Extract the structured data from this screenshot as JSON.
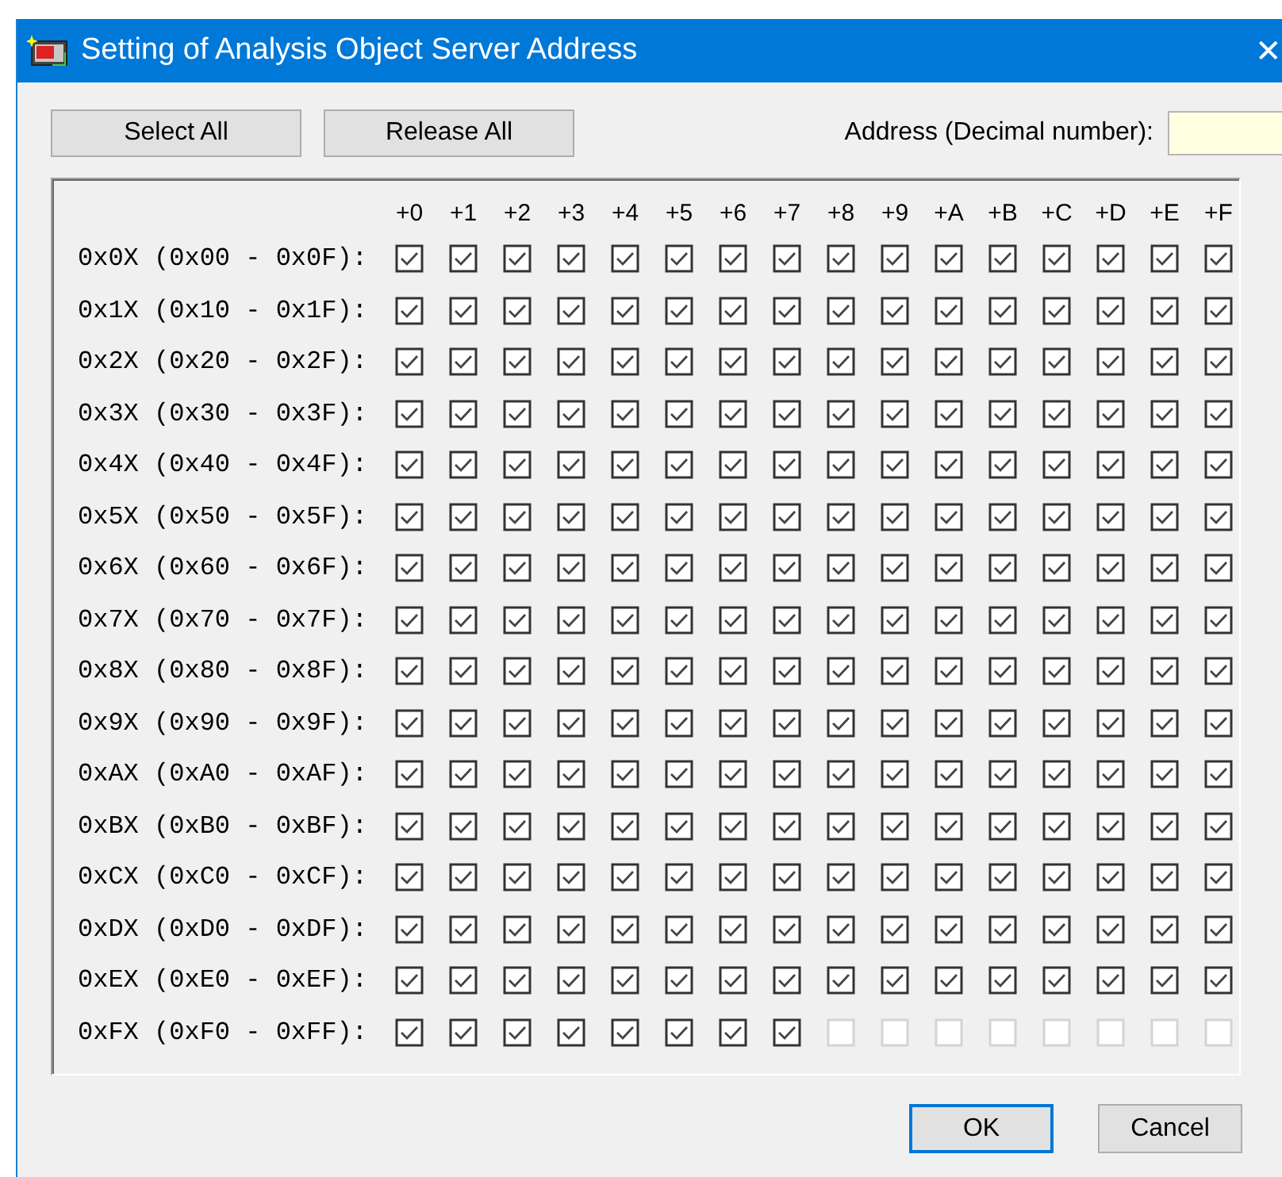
{
  "window": {
    "title": "Setting of Analysis Object Server Address",
    "close": "✕"
  },
  "buttons": [
    {
      "label": "Select All"
    },
    {
      "label": "Release All"
    }
  ],
  "address": {
    "label": "Address (Decimal number):"
  },
  "columns": [
    "+0",
    "+1",
    "+2",
    "+3",
    "+4",
    "+5",
    "+6",
    "+7",
    "+8",
    "+9",
    "+A",
    "+B",
    "+C",
    "+D",
    "+E",
    "+F"
  ],
  "rows": [
    {
      "label": "0x0X (0x00 - 0x0F):",
      "cells": [
        {
          "checked": true,
          "disabled": false
        },
        {
          "checked": true,
          "disabled": false
        },
        {
          "checked": true,
          "disabled": false
        },
        {
          "checked": true,
          "disabled": false
        },
        {
          "checked": true,
          "disabled": false
        },
        {
          "checked": true,
          "disabled": false
        },
        {
          "checked": true,
          "disabled": false
        },
        {
          "checked": true,
          "disabled": false
        },
        {
          "checked": true,
          "disabled": false
        },
        {
          "checked": true,
          "disabled": false
        },
        {
          "checked": true,
          "disabled": false
        },
        {
          "checked": true,
          "disabled": false
        },
        {
          "checked": true,
          "disabled": false
        },
        {
          "checked": true,
          "disabled": false
        },
        {
          "checked": true,
          "disabled": false
        },
        {
          "checked": true,
          "disabled": false
        }
      ]
    },
    {
      "label": "0x1X (0x10 - 0x1F):",
      "cells": [
        {
          "checked": true,
          "disabled": false
        },
        {
          "checked": true,
          "disabled": false
        },
        {
          "checked": true,
          "disabled": false
        },
        {
          "checked": true,
          "disabled": false
        },
        {
          "checked": true,
          "disabled": false
        },
        {
          "checked": true,
          "disabled": false
        },
        {
          "checked": true,
          "disabled": false
        },
        {
          "checked": true,
          "disabled": false
        },
        {
          "checked": true,
          "disabled": false
        },
        {
          "checked": true,
          "disabled": false
        },
        {
          "checked": true,
          "disabled": false
        },
        {
          "checked": true,
          "disabled": false
        },
        {
          "checked": true,
          "disabled": false
        },
        {
          "checked": true,
          "disabled": false
        },
        {
          "checked": true,
          "disabled": false
        },
        {
          "checked": true,
          "disabled": false
        }
      ]
    },
    {
      "label": "0x2X (0x20 - 0x2F):",
      "cells": [
        {
          "checked": true,
          "disabled": false
        },
        {
          "checked": true,
          "disabled": false
        },
        {
          "checked": true,
          "disabled": false
        },
        {
          "checked": true,
          "disabled": false
        },
        {
          "checked": true,
          "disabled": false
        },
        {
          "checked": true,
          "disabled": false
        },
        {
          "checked": true,
          "disabled": false
        },
        {
          "checked": true,
          "disabled": false
        },
        {
          "checked": true,
          "disabled": false
        },
        {
          "checked": true,
          "disabled": false
        },
        {
          "checked": true,
          "disabled": false
        },
        {
          "checked": true,
          "disabled": false
        },
        {
          "checked": true,
          "disabled": false
        },
        {
          "checked": true,
          "disabled": false
        },
        {
          "checked": true,
          "disabled": false
        },
        {
          "checked": true,
          "disabled": false
        }
      ]
    },
    {
      "label": "0x3X (0x30 - 0x3F):",
      "cells": [
        {
          "checked": true,
          "disabled": false
        },
        {
          "checked": true,
          "disabled": false
        },
        {
          "checked": true,
          "disabled": false
        },
        {
          "checked": true,
          "disabled": false
        },
        {
          "checked": true,
          "disabled": false
        },
        {
          "checked": true,
          "disabled": false
        },
        {
          "checked": true,
          "disabled": false
        },
        {
          "checked": true,
          "disabled": false
        },
        {
          "checked": true,
          "disabled": false
        },
        {
          "checked": true,
          "disabled": false
        },
        {
          "checked": true,
          "disabled": false
        },
        {
          "checked": true,
          "disabled": false
        },
        {
          "checked": true,
          "disabled": false
        },
        {
          "checked": true,
          "disabled": false
        },
        {
          "checked": true,
          "disabled": false
        },
        {
          "checked": true,
          "disabled": false
        }
      ]
    },
    {
      "label": "0x4X (0x40 - 0x4F):",
      "cells": [
        {
          "checked": true,
          "disabled": false
        },
        {
          "checked": true,
          "disabled": false
        },
        {
          "checked": true,
          "disabled": false
        },
        {
          "checked": true,
          "disabled": false
        },
        {
          "checked": true,
          "disabled": false
        },
        {
          "checked": true,
          "disabled": false
        },
        {
          "checked": true,
          "disabled": false
        },
        {
          "checked": true,
          "disabled": false
        },
        {
          "checked": true,
          "disabled": false
        },
        {
          "checked": true,
          "disabled": false
        },
        {
          "checked": true,
          "disabled": false
        },
        {
          "checked": true,
          "disabled": false
        },
        {
          "checked": true,
          "disabled": false
        },
        {
          "checked": true,
          "disabled": false
        },
        {
          "checked": true,
          "disabled": false
        },
        {
          "checked": true,
          "disabled": false
        }
      ]
    },
    {
      "label": "0x5X (0x50 - 0x5F):",
      "cells": [
        {
          "checked": true,
          "disabled": false
        },
        {
          "checked": true,
          "disabled": false
        },
        {
          "checked": true,
          "disabled": false
        },
        {
          "checked": true,
          "disabled": false
        },
        {
          "checked": true,
          "disabled": false
        },
        {
          "checked": true,
          "disabled": false
        },
        {
          "checked": true,
          "disabled": false
        },
        {
          "checked": true,
          "disabled": false
        },
        {
          "checked": true,
          "disabled": false
        },
        {
          "checked": true,
          "disabled": false
        },
        {
          "checked": true,
          "disabled": false
        },
        {
          "checked": true,
          "disabled": false
        },
        {
          "checked": true,
          "disabled": false
        },
        {
          "checked": true,
          "disabled": false
        },
        {
          "checked": true,
          "disabled": false
        },
        {
          "checked": true,
          "disabled": false
        }
      ]
    },
    {
      "label": "0x6X (0x60 - 0x6F):",
      "cells": [
        {
          "checked": true,
          "disabled": false
        },
        {
          "checked": true,
          "disabled": false
        },
        {
          "checked": true,
          "disabled": false
        },
        {
          "checked": true,
          "disabled": false
        },
        {
          "checked": true,
          "disabled": false
        },
        {
          "checked": true,
          "disabled": false
        },
        {
          "checked": true,
          "disabled": false
        },
        {
          "checked": true,
          "disabled": false
        },
        {
          "checked": true,
          "disabled": false
        },
        {
          "checked": true,
          "disabled": false
        },
        {
          "checked": true,
          "disabled": false
        },
        {
          "checked": true,
          "disabled": false
        },
        {
          "checked": true,
          "disabled": false
        },
        {
          "checked": true,
          "disabled": false
        },
        {
          "checked": true,
          "disabled": false
        },
        {
          "checked": true,
          "disabled": false
        }
      ]
    },
    {
      "label": "0x7X (0x70 - 0x7F):",
      "cells": [
        {
          "checked": true,
          "disabled": false
        },
        {
          "checked": true,
          "disabled": false
        },
        {
          "checked": true,
          "disabled": false
        },
        {
          "checked": true,
          "disabled": false
        },
        {
          "checked": true,
          "disabled": false
        },
        {
          "checked": true,
          "disabled": false
        },
        {
          "checked": true,
          "disabled": false
        },
        {
          "checked": true,
          "disabled": false
        },
        {
          "checked": true,
          "disabled": false
        },
        {
          "checked": true,
          "disabled": false
        },
        {
          "checked": true,
          "disabled": false
        },
        {
          "checked": true,
          "disabled": false
        },
        {
          "checked": true,
          "disabled": false
        },
        {
          "checked": true,
          "disabled": false
        },
        {
          "checked": true,
          "disabled": false
        },
        {
          "checked": true,
          "disabled": false
        }
      ]
    },
    {
      "label": "0x8X (0x80 - 0x8F):",
      "cells": [
        {
          "checked": true,
          "disabled": false
        },
        {
          "checked": true,
          "disabled": false
        },
        {
          "checked": true,
          "disabled": false
        },
        {
          "checked": true,
          "disabled": false
        },
        {
          "checked": true,
          "disabled": false
        },
        {
          "checked": true,
          "disabled": false
        },
        {
          "checked": true,
          "disabled": false
        },
        {
          "checked": true,
          "disabled": false
        },
        {
          "checked": true,
          "disabled": false
        },
        {
          "checked": true,
          "disabled": false
        },
        {
          "checked": true,
          "disabled": false
        },
        {
          "checked": true,
          "disabled": false
        },
        {
          "checked": true,
          "disabled": false
        },
        {
          "checked": true,
          "disabled": false
        },
        {
          "checked": true,
          "disabled": false
        },
        {
          "checked": true,
          "disabled": false
        }
      ]
    },
    {
      "label": "0x9X (0x90 - 0x9F):",
      "cells": [
        {
          "checked": true,
          "disabled": false
        },
        {
          "checked": true,
          "disabled": false
        },
        {
          "checked": true,
          "disabled": false
        },
        {
          "checked": true,
          "disabled": false
        },
        {
          "checked": true,
          "disabled": false
        },
        {
          "checked": true,
          "disabled": false
        },
        {
          "checked": true,
          "disabled": false
        },
        {
          "checked": true,
          "disabled": false
        },
        {
          "checked": true,
          "disabled": false
        },
        {
          "checked": true,
          "disabled": false
        },
        {
          "checked": true,
          "disabled": false
        },
        {
          "checked": true,
          "disabled": false
        },
        {
          "checked": true,
          "disabled": false
        },
        {
          "checked": true,
          "disabled": false
        },
        {
          "checked": true,
          "disabled": false
        },
        {
          "checked": true,
          "disabled": false
        }
      ]
    },
    {
      "label": "0xAX (0xA0 - 0xAF):",
      "cells": [
        {
          "checked": true,
          "disabled": false
        },
        {
          "checked": true,
          "disabled": false
        },
        {
          "checked": true,
          "disabled": false
        },
        {
          "checked": true,
          "disabled": false
        },
        {
          "checked": true,
          "disabled": false
        },
        {
          "checked": true,
          "disabled": false
        },
        {
          "checked": true,
          "disabled": false
        },
        {
          "checked": true,
          "disabled": false
        },
        {
          "checked": true,
          "disabled": false
        },
        {
          "checked": true,
          "disabled": false
        },
        {
          "checked": true,
          "disabled": false
        },
        {
          "checked": true,
          "disabled": false
        },
        {
          "checked": true,
          "disabled": false
        },
        {
          "checked": true,
          "disabled": false
        },
        {
          "checked": true,
          "disabled": false
        },
        {
          "checked": true,
          "disabled": false
        }
      ]
    },
    {
      "label": "0xBX (0xB0 - 0xBF):",
      "cells": [
        {
          "checked": true,
          "disabled": false
        },
        {
          "checked": true,
          "disabled": false
        },
        {
          "checked": true,
          "disabled": false
        },
        {
          "checked": true,
          "disabled": false
        },
        {
          "checked": true,
          "disabled": false
        },
        {
          "checked": true,
          "disabled": false
        },
        {
          "checked": true,
          "disabled": false
        },
        {
          "checked": true,
          "disabled": false
        },
        {
          "checked": true,
          "disabled": false
        },
        {
          "checked": true,
          "disabled": false
        },
        {
          "checked": true,
          "disabled": false
        },
        {
          "checked": true,
          "disabled": false
        },
        {
          "checked": true,
          "disabled": false
        },
        {
          "checked": true,
          "disabled": false
        },
        {
          "checked": true,
          "disabled": false
        },
        {
          "checked": true,
          "disabled": false
        }
      ]
    },
    {
      "label": "0xCX (0xC0 - 0xCF):",
      "cells": [
        {
          "checked": true,
          "disabled": false
        },
        {
          "checked": true,
          "disabled": false
        },
        {
          "checked": true,
          "disabled": false
        },
        {
          "checked": true,
          "disabled": false
        },
        {
          "checked": true,
          "disabled": false
        },
        {
          "checked": true,
          "disabled": false
        },
        {
          "checked": true,
          "disabled": false
        },
        {
          "checked": true,
          "disabled": false
        },
        {
          "checked": true,
          "disabled": false
        },
        {
          "checked": true,
          "disabled": false
        },
        {
          "checked": true,
          "disabled": false
        },
        {
          "checked": true,
          "disabled": false
        },
        {
          "checked": true,
          "disabled": false
        },
        {
          "checked": true,
          "disabled": false
        },
        {
          "checked": true,
          "disabled": false
        },
        {
          "checked": true,
          "disabled": false
        }
      ]
    },
    {
      "label": "0xDX (0xD0 - 0xDF):",
      "cells": [
        {
          "checked": true,
          "disabled": false
        },
        {
          "checked": true,
          "disabled": false
        },
        {
          "checked": true,
          "disabled": false
        },
        {
          "checked": true,
          "disabled": false
        },
        {
          "checked": true,
          "disabled": false
        },
        {
          "checked": true,
          "disabled": false
        },
        {
          "checked": true,
          "disabled": false
        },
        {
          "checked": true,
          "disabled": false
        },
        {
          "checked": true,
          "disabled": false
        },
        {
          "checked": true,
          "disabled": false
        },
        {
          "checked": true,
          "disabled": false
        },
        {
          "checked": true,
          "disabled": false
        },
        {
          "checked": true,
          "disabled": false
        },
        {
          "checked": true,
          "disabled": false
        },
        {
          "checked": true,
          "disabled": false
        },
        {
          "checked": true,
          "disabled": false
        }
      ]
    },
    {
      "label": "0xEX (0xE0 - 0xEF):",
      "cells": [
        {
          "checked": true,
          "disabled": false
        },
        {
          "checked": true,
          "disabled": false
        },
        {
          "checked": true,
          "disabled": false
        },
        {
          "checked": true,
          "disabled": false
        },
        {
          "checked": true,
          "disabled": false
        },
        {
          "checked": true,
          "disabled": false
        },
        {
          "checked": true,
          "disabled": false
        },
        {
          "checked": true,
          "disabled": false
        },
        {
          "checked": true,
          "disabled": false
        },
        {
          "checked": true,
          "disabled": false
        },
        {
          "checked": true,
          "disabled": false
        },
        {
          "checked": true,
          "disabled": false
        },
        {
          "checked": true,
          "disabled": false
        },
        {
          "checked": true,
          "disabled": false
        },
        {
          "checked": true,
          "disabled": false
        },
        {
          "checked": true,
          "disabled": false
        }
      ]
    },
    {
      "label": "0xFX (0xF0 - 0xFF):",
      "cells": [
        {
          "checked": true,
          "disabled": false
        },
        {
          "checked": true,
          "disabled": false
        },
        {
          "checked": true,
          "disabled": false
        },
        {
          "checked": true,
          "disabled": false
        },
        {
          "checked": true,
          "disabled": false
        },
        {
          "checked": true,
          "disabled": false
        },
        {
          "checked": true,
          "disabled": false
        },
        {
          "checked": true,
          "disabled": false
        },
        {
          "checked": false,
          "disabled": true
        },
        {
          "checked": false,
          "disabled": true
        },
        {
          "checked": false,
          "disabled": true
        },
        {
          "checked": false,
          "disabled": true
        },
        {
          "checked": false,
          "disabled": true
        },
        {
          "checked": false,
          "disabled": true
        },
        {
          "checked": false,
          "disabled": true
        },
        {
          "checked": false,
          "disabled": true
        }
      ]
    }
  ],
  "footer_buttons": [
    {
      "label": "OK",
      "default": true
    },
    {
      "label": "Cancel",
      "default": false
    }
  ]
}
